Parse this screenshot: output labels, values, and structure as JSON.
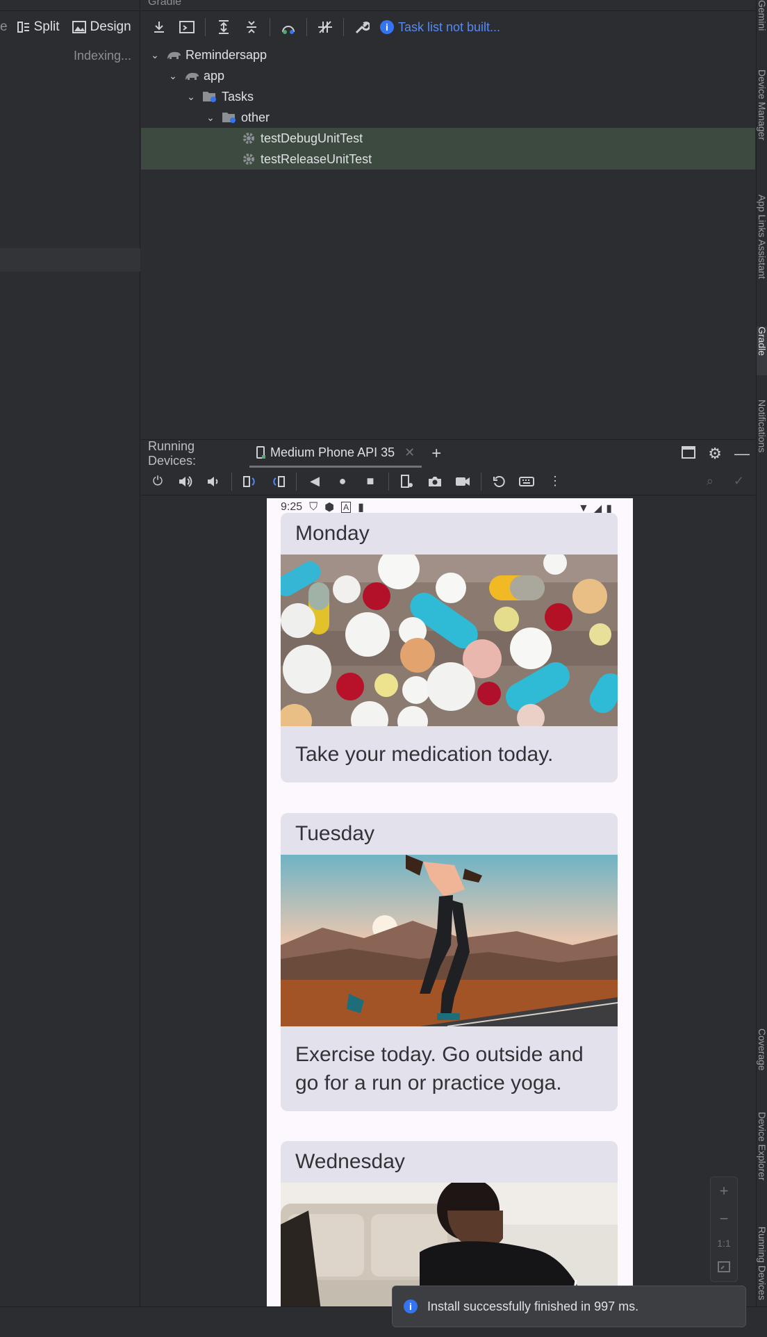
{
  "editor": {
    "mode_partial": "e",
    "split_label": "Split",
    "design_label": "Design",
    "indexing": "Indexing..."
  },
  "gradle": {
    "header": "Gradle",
    "task_status": "Task list not built...",
    "tree": [
      {
        "label": "Remindersapp",
        "icon": "elephant-icon"
      },
      {
        "label": "app",
        "icon": "elephant-icon"
      },
      {
        "label": "Tasks",
        "icon": "folder-gear-icon"
      },
      {
        "label": "other",
        "icon": "folder-gear-icon"
      },
      {
        "label": "testDebugUnitTest",
        "icon": "gear-icon"
      },
      {
        "label": "testReleaseUnitTest",
        "icon": "gear-icon"
      }
    ]
  },
  "running_devices": {
    "title": "Running Devices:",
    "device_tab": "Medium Phone API 35"
  },
  "phone": {
    "time": "9:25",
    "cards": [
      {
        "title": "Monday",
        "text": "Take your medication today.",
        "image": "pills"
      },
      {
        "title": "Tuesday",
        "text": "Exercise today. Go outside and go for a run or practice yoga.",
        "image": "runner"
      },
      {
        "title": "Wednesday",
        "text": "",
        "image": "studying"
      }
    ]
  },
  "zoom": {
    "one_to_one": "1:1"
  },
  "right_stripe": [
    "Gemini",
    "Device Manager",
    "App Links Assistant",
    "Gradle",
    "Notifications",
    "Coverage",
    "Device Explorer",
    "Running Devices"
  ],
  "toast": {
    "message": "Install successfully finished in 997 ms."
  },
  "colors": {
    "accent": "#548af7",
    "selection": "#3d4a3f",
    "card": "#e3e1eb"
  }
}
